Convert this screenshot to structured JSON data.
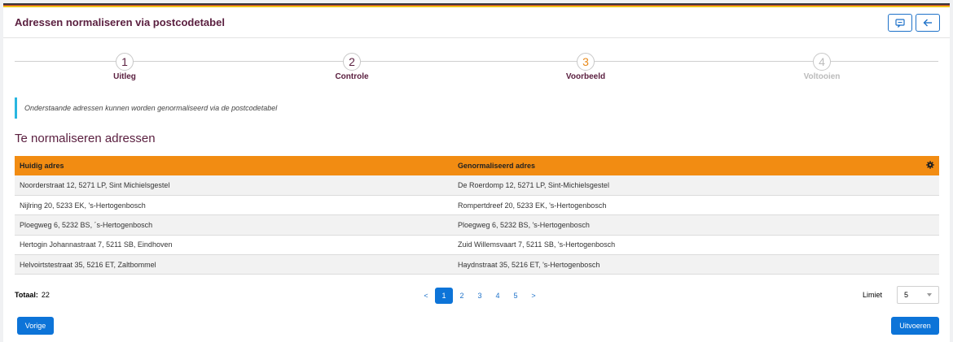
{
  "header": {
    "title": "Adressen normaliseren via postcodetabel"
  },
  "colors": {
    "stripe": [
      "#3a3a3a",
      "#c0392b",
      "#f0c419"
    ],
    "accent": "#f28c12",
    "primary": "#0d74d8",
    "title": "#5b2040"
  },
  "icons": {
    "feedback": "comment-icon",
    "back": "arrow-left-icon",
    "settings": "gear-icon"
  },
  "steps": [
    {
      "number": "1",
      "label": "Uitleg",
      "state": "done"
    },
    {
      "number": "2",
      "label": "Controle",
      "state": "done"
    },
    {
      "number": "3",
      "label": "Voorbeeld",
      "state": "active"
    },
    {
      "number": "4",
      "label": "Voltooien",
      "state": "disabled"
    }
  ],
  "info": {
    "text": "Onderstaande adressen kunnen worden genormaliseerd via de postcodetabel"
  },
  "section": {
    "title": "Te normaliseren adressen"
  },
  "table": {
    "columns": [
      "Huidig adres",
      "Genormaliseerd adres"
    ],
    "rows": [
      [
        "Noorderstraat 12, 5271 LP, Sint Michielsgestel",
        "De Roerdomp 12, 5271 LP, Sint-Michielsgestel"
      ],
      [
        "Nijlring 20, 5233 EK, 's-Hertogenbosch",
        "Rompertdreef 20, 5233 EK, 's-Hertogenbosch"
      ],
      [
        "Ploegweg 6, 5232 BS, ´s-Hertogenbosch",
        "Ploegweg 6, 5232 BS, 's-Hertogenbosch"
      ],
      [
        "Hertogin Johannastraat 7, 5211 SB, Eindhoven",
        "Zuid Willemsvaart 7, 5211 SB, 's-Hertogenbosch"
      ],
      [
        "Helvoirtstestraat 35, 5216 ET, Zaltbommel",
        "Haydnstraat 35, 5216 ET, 's-Hertogenbosch"
      ]
    ]
  },
  "footer": {
    "total_label": "Totaal:",
    "total_value": "22",
    "pager": {
      "prev": "<",
      "pages": [
        "1",
        "2",
        "3",
        "4",
        "5"
      ],
      "current": "1",
      "next": ">"
    },
    "limit_label": "Limiet",
    "limit_value": "5"
  },
  "buttons": {
    "previous": "Vorige",
    "execute": "Uitvoeren"
  }
}
